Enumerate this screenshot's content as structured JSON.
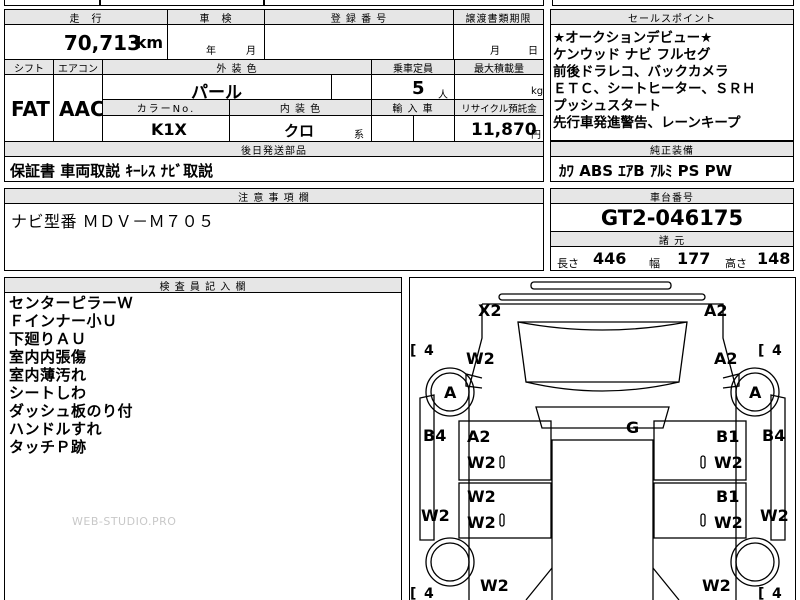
{
  "top": {
    "mileage_header": "走　行",
    "mileage_value": "70,713",
    "mileage_unit": "km",
    "inspection_header": "車　検",
    "inspection_year_unit": "年",
    "inspection_month_unit": "月",
    "registration_header": "登 録 番 号",
    "transfer_header": "譲渡書類期限",
    "transfer_month_unit": "月",
    "transfer_day_unit": "日",
    "shift_header": "シフト",
    "shift_value": "FAT",
    "aircon_header": "エアコン",
    "aircon_value": "AAC",
    "exterior_color_header": "外 装 色",
    "exterior_color_value": "パール",
    "capacity_header": "乗車定員",
    "capacity_value": "5",
    "capacity_unit": "人",
    "max_load_header": "最大積載量",
    "max_load_unit": "kg",
    "color_no_header": "カラーNo.",
    "color_no_value": "K1X",
    "interior_color_header": "内 装 色",
    "interior_color_value": "クロ",
    "interior_color_suffix": "系",
    "import_header": "輸 入 車",
    "recycle_header": "リサイクル預託金",
    "recycle_value": "11,870",
    "recycle_unit": "円"
  },
  "sales_points": {
    "header": "セールスポイント",
    "lines": [
      "★オークションデビュー★",
      "ケンウッド ナビ フルセグ",
      "前後ドラレコ、バックカメラ",
      "ＥＴＣ、シートヒーター、ＳＲＨ",
      "プッシュスタート",
      "先行車発進警告、レーンキープ"
    ]
  },
  "later_parts": {
    "header": "後日発送部品",
    "value": "保証書 車両取説 ｷｰﾚｽ ﾅﾋﾞ取説"
  },
  "genuine_equipment": {
    "header": "純正装備",
    "value": "ｶﾜ ABS ｴｱB ｱﾙﾐ PS PW"
  },
  "notes": {
    "header": "注 意 事 項 欄",
    "value": "ナビ型番 ＭＤＶ－Ｍ７０５"
  },
  "chassis": {
    "header": "車台番号",
    "value": "GT2-046175"
  },
  "dimensions": {
    "header": "諸 元",
    "length_label": "長さ",
    "length_value": "446",
    "width_label": "幅",
    "width_value": "177",
    "height_label": "高さ",
    "height_value": "148"
  },
  "inspector": {
    "header": "検 査 員 記 入 欄",
    "lines": [
      "センターピラーＷ",
      "Ｆインナー小Ｕ",
      "下廻りＡＵ",
      "室内内張傷",
      "室内薄汚れ",
      "シートしわ",
      "ダッシュ板のり付",
      "ハンドルすれ",
      "タッチＰ跡"
    ],
    "watermark": "WEB-STUDIO.PRO"
  },
  "diagram": {
    "marks": [
      "X2",
      "A2",
      "W2",
      "A2",
      "A",
      "A",
      "G",
      "A2",
      "B1",
      "B4",
      "B4",
      "W2",
      "W2",
      "W2",
      "B1",
      "W2",
      "W2",
      "W2",
      "W2",
      "W2",
      "4",
      "4",
      "4",
      "4"
    ]
  }
}
